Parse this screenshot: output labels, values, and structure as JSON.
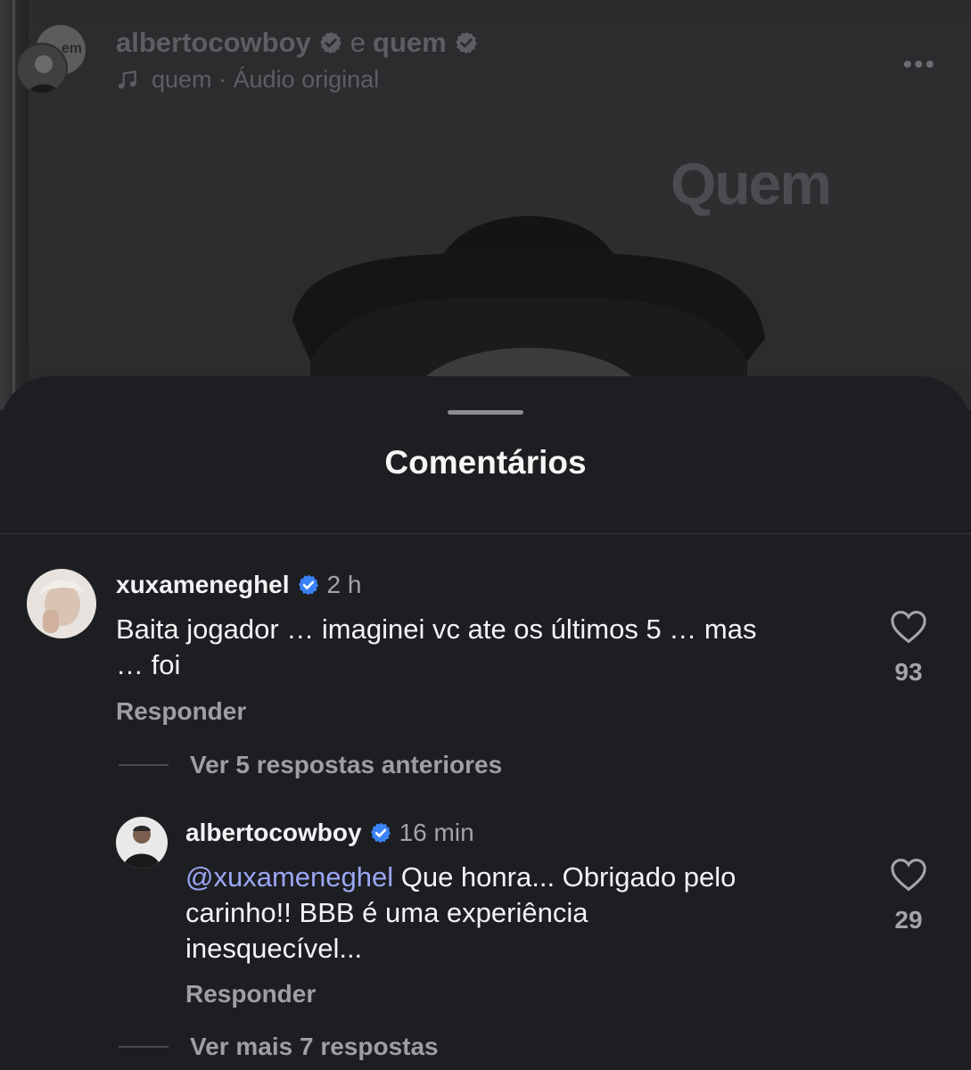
{
  "reel": {
    "author": "albertocowboy",
    "connector": "e",
    "coauthor": "quem",
    "audio_label": "quem · Áudio original",
    "watermark": "Quem",
    "avatar_text": "em",
    "more_label": "•••"
  },
  "sheet": {
    "title": "Comentários"
  },
  "comments": [
    {
      "user": "xuxameneghel",
      "time": "2 h",
      "line1": "Baita jogador … imaginei vc ate os  últimos 5 … mas",
      "line2": "… foi",
      "likes": "93",
      "reply_label": "Responder",
      "replies_label": "Ver 5 respostas anteriores"
    },
    {
      "user": "albertocowboy",
      "time": "16 min",
      "mention": "@xuxameneghel",
      "line1": " Que honra... Obrigado pelo",
      "line2": "carinho!! BBB é uma experiência",
      "line3": "inesquecível...",
      "likes": "29",
      "reply_label": "Responder",
      "replies_label": "Ver mais 7 respostas"
    }
  ],
  "colors": {
    "verified": "#3b82f6",
    "mention": "#9aa6f5",
    "sheet_bg": "#1d1e21"
  },
  "icons": [
    "verified-badge-icon",
    "music-note-icon",
    "heart-icon",
    "more-options-icon"
  ]
}
